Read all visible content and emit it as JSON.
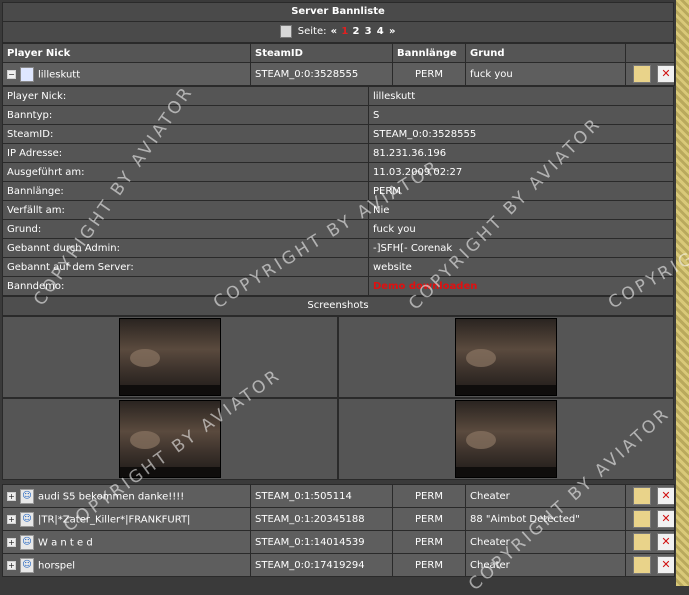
{
  "title": "Server Bannliste",
  "pager": {
    "label": "Seite:",
    "prev": "«",
    "current": "1",
    "pages": [
      "2",
      "3",
      "4"
    ],
    "next": "»"
  },
  "columns": [
    "Player Nick",
    "SteamID",
    "Bannlänge",
    "Grund"
  ],
  "expanded": {
    "nick": "lilleskutt",
    "steam": "STEAM_0:0:3528555",
    "length": "PERM",
    "reason": "fuck you"
  },
  "details": [
    {
      "label": "Player Nick:",
      "value": "lilleskutt"
    },
    {
      "label": "Banntyp:",
      "value": "S"
    },
    {
      "label": "SteamID:",
      "value": "STEAM_0:0:3528555"
    },
    {
      "label": "IP Adresse:",
      "value": "81.231.36.196"
    },
    {
      "label": "Ausgeführt am:",
      "value": "11.03.2009 02:27"
    },
    {
      "label": "Bannlänge:",
      "value": "PERM"
    },
    {
      "label": "Verfällt am:",
      "value": "Nie"
    },
    {
      "label": "Grund:",
      "value": "fuck you"
    },
    {
      "label": "Gebannt durch Admin:",
      "value": "-]SFH[- Corenak"
    },
    {
      "label": "Gebannt auf dem Server:",
      "value": "website"
    },
    {
      "label": "Banndemo:",
      "value": "Demo downloaden"
    }
  ],
  "screenshots_label": "Screenshots",
  "rows": [
    {
      "nick": "audi S5 bekommen danke!!!!",
      "steam": "STEAM_0:1:505114",
      "length": "PERM",
      "reason": "Cheater"
    },
    {
      "nick": "|TR|*Zater_Killer*|FRANKFURT|",
      "steam": "STEAM_0:1:20345188",
      "length": "PERM",
      "reason": "88 \"Aimbot Detected\""
    },
    {
      "nick": "W a n t e d",
      "steam": "STEAM_0:1:14014539",
      "length": "PERM",
      "reason": "Cheater"
    },
    {
      "nick": "horspel",
      "steam": "STEAM_0:0:17419294",
      "length": "PERM",
      "reason": "Cheater"
    }
  ],
  "watermark": "COPYRIGHT BY AVIATOR",
  "icons": {
    "toggle_open": "minus-icon",
    "toggle_closed": "plus-icon",
    "edit": "edit-icon",
    "delete": "delete-icon"
  }
}
